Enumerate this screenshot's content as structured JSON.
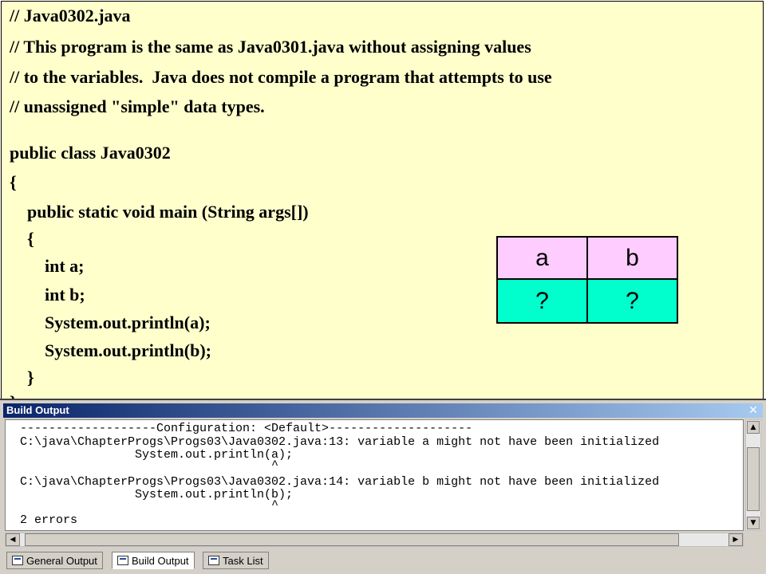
{
  "code": {
    "lines": [
      "// Java0302.java",
      "// This program is the same as Java0301.java without assigning values",
      "// to the variables.  Java does not compile a program that attempts to use",
      "// unassigned \"simple\" data types.",
      "public class Java0302",
      "{",
      "    public static void main (String args[])",
      "    {",
      "        int a;",
      "        int b;",
      "        System.out.println(a);",
      "        System.out.println(b);",
      "    }",
      "}"
    ]
  },
  "memory_table": {
    "headers": [
      "a",
      "b"
    ],
    "values": [
      "?",
      "?"
    ]
  },
  "build_output": {
    "title": "Build Output",
    "lines": [
      "-------------------Configuration: <Default>--------------------",
      "C:\\java\\ChapterProgs\\Progs03\\Java0302.java:13: variable a might not have been initialized",
      "                System.out.println(a);",
      "                                   ^",
      "C:\\java\\ChapterProgs\\Progs03\\Java0302.java:14: variable b might not have been initialized",
      "                System.out.println(b);",
      "                                   ^",
      "2 errors"
    ],
    "close_glyph": "✕",
    "tabs": [
      "General Output",
      "Build Output",
      "Task List"
    ],
    "active_tab": "Build Output"
  },
  "colors": {
    "code_background": "#ffffcc",
    "table_header": "#ffccff",
    "table_values": "#00ffcc",
    "titlebar": "#0a246a"
  }
}
